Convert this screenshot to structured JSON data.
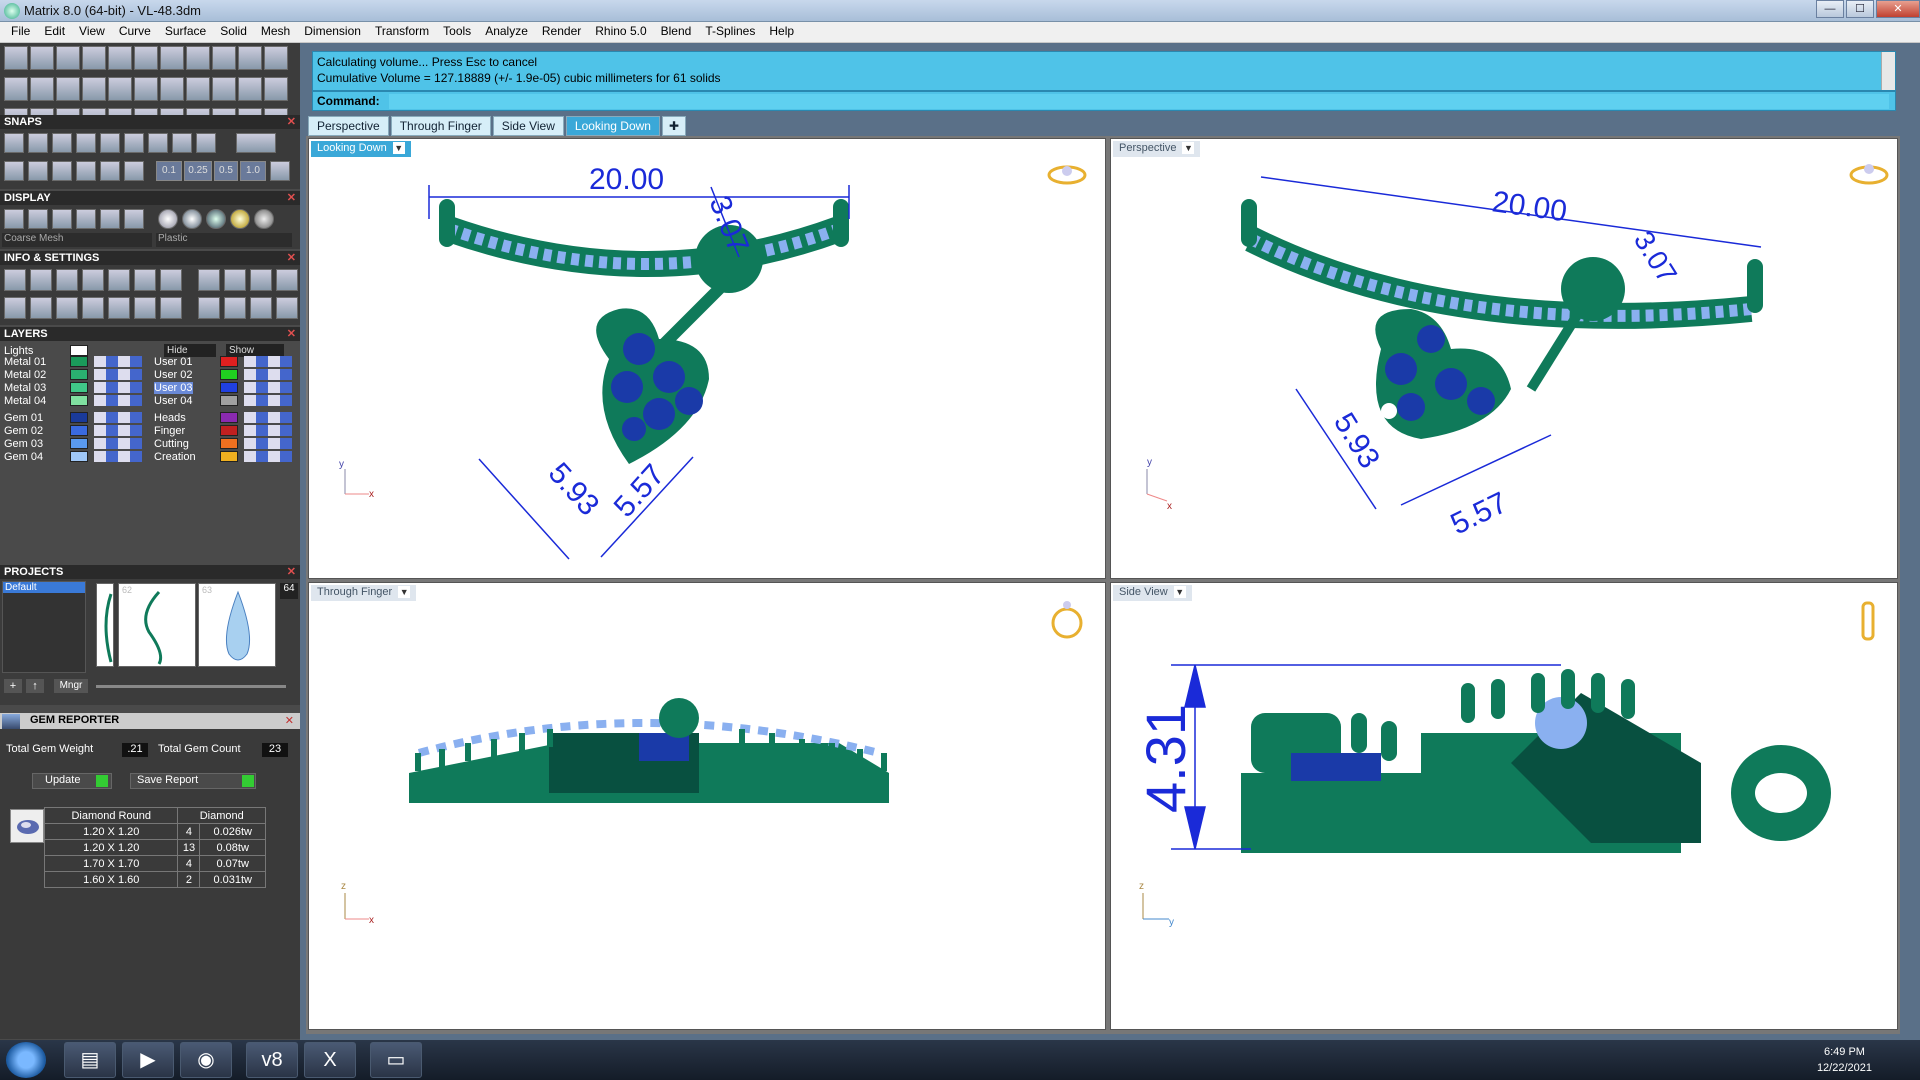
{
  "window": {
    "title": "Matrix 8.0 (64-bit) - VL-48.3dm",
    "min": "—",
    "max": "☐",
    "close": "✕"
  },
  "menu": [
    "File",
    "Edit",
    "View",
    "Curve",
    "Surface",
    "Solid",
    "Mesh",
    "Dimension",
    "Transform",
    "Tools",
    "Analyze",
    "Render",
    "Rhino 5.0",
    "Blend",
    "T-Splines",
    "Help"
  ],
  "command": {
    "line1": "Calculating volume... Press Esc to cancel",
    "line2": "Cumulative Volume = 127.18889 (+/- 1.9e-05) cubic millimeters for 61 solids",
    "prompt": "Command:"
  },
  "tabs": [
    "Perspective",
    "Through Finger",
    "Side View",
    "Looking Down"
  ],
  "active_tab": "Looking Down",
  "sections": {
    "snaps": "SNAPS",
    "display": "DISPLAY",
    "info": "INFO & SETTINGS",
    "layers": "LAYERS",
    "projects": "PROJECTS",
    "gem_reporter": "GEM REPORTER"
  },
  "snap_values": [
    "0.1",
    "0.25",
    "0.5",
    "1.0"
  ],
  "display": {
    "mesh": "Coarse Mesh",
    "material": "Plastic"
  },
  "layers": {
    "lights": "Lights",
    "hide": "Hide",
    "show": "Show",
    "left": [
      {
        "name": "Metal 01",
        "color": "#1a9a5a"
      },
      {
        "name": "Metal 02",
        "color": "#2ab070"
      },
      {
        "name": "Metal 03",
        "color": "#40c888"
      },
      {
        "name": "Metal 04",
        "color": "#80e0a0"
      },
      {
        "name": "Gem 01",
        "color": "#1a3a9a"
      },
      {
        "name": "Gem 02",
        "color": "#3a6ae0"
      },
      {
        "name": "Gem 03",
        "color": "#5a9af0"
      },
      {
        "name": "Gem 04",
        "color": "#a0c8f8"
      }
    ],
    "right": [
      {
        "name": "User 01",
        "color": "#e02020"
      },
      {
        "name": "User 02",
        "color": "#20d020"
      },
      {
        "name": "User 03",
        "color": "#2040e0"
      },
      {
        "name": "User 04",
        "color": "#a0a0a0"
      },
      {
        "name": "Heads",
        "color": "#8a2ab0"
      },
      {
        "name": "Finger",
        "color": "#c02020"
      },
      {
        "name": "Cutting",
        "color": "#f07020"
      },
      {
        "name": "Creation",
        "color": "#f0b020"
      }
    ]
  },
  "projects": {
    "default": "Default",
    "thumbs": [
      "62",
      "63",
      "64"
    ],
    "mngr": "Mngr"
  },
  "gem": {
    "total_weight_label": "Total Gem Weight",
    "total_weight": ".21",
    "total_count_label": "Total Gem Count",
    "total_count": "23",
    "update": "Update",
    "save_report": "Save Report",
    "headers": [
      "Diamond Round",
      "Diamond"
    ],
    "rows": [
      {
        "size": "1.20 X 1.20",
        "qty": "4",
        "wt": "0.026tw"
      },
      {
        "size": "1.20 X 1.20",
        "qty": "13",
        "wt": "0.08tw"
      },
      {
        "size": "1.70 X 1.70",
        "qty": "4",
        "wt": "0.07tw"
      },
      {
        "size": "1.60 X 1.60",
        "qty": "2",
        "wt": "0.031tw"
      }
    ]
  },
  "viewports": {
    "top_left": {
      "label": "Looking Down",
      "dim_main": "20.00",
      "dim_a": "3.07",
      "dim_b": "5.93",
      "dim_c": "5.57",
      "ax_y": "y",
      "ax_x": "x"
    },
    "top_right": {
      "label": "Perspective",
      "dim_main": "20.00",
      "dim_a": "3.07",
      "dim_b": "5.93",
      "dim_c": "5.57",
      "ax_y": "y",
      "ax_x": "x"
    },
    "bottom_left": {
      "label": "Through Finger",
      "ax_z": "z",
      "ax_x": "x"
    },
    "bottom_right": {
      "label": "Side View",
      "dim_main": "4.31",
      "ax_z": "z",
      "ax_y": "y"
    }
  },
  "clock": {
    "time": "6:49 PM",
    "date": "12/22/2021"
  },
  "colors": {
    "metal": "#0f7a5a",
    "metal_dark": "#085040",
    "gem_light": "#8ab0f0",
    "gem_dark": "#1a3aa8",
    "dim": "#1a2ad8"
  }
}
